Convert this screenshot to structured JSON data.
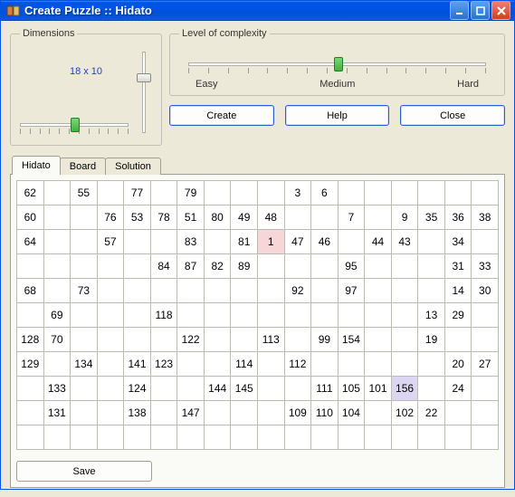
{
  "window": {
    "title": "Create Puzzle :: Hidato"
  },
  "dimensions": {
    "legend": "Dimensions",
    "value": "18 x 10"
  },
  "complexity": {
    "legend": "Level of complexity",
    "labels": {
      "easy": "Easy",
      "medium": "Medium",
      "hard": "Hard"
    }
  },
  "buttons": {
    "create": "Create",
    "help": "Help",
    "close": "Close",
    "save": "Save"
  },
  "tabs": {
    "hidato": "Hidato",
    "board": "Board",
    "solution": "Solution"
  },
  "grid": {
    "cols": 18,
    "rows": 11,
    "cells": [
      [
        "62",
        "",
        "55",
        "",
        "77",
        "",
        "79",
        "",
        "",
        "",
        "3",
        "6",
        "",
        "",
        "",
        "",
        "",
        ""
      ],
      [
        "60",
        "",
        "",
        "76",
        "53",
        "78",
        "51",
        "80",
        "49",
        "48",
        "",
        "",
        "7",
        "",
        "9",
        "35",
        "36",
        "38"
      ],
      [
        "64",
        "",
        "",
        "57",
        "",
        "",
        "83",
        "",
        "81",
        "1",
        "47",
        "46",
        "",
        "44",
        "43",
        "",
        "34",
        ""
      ],
      [
        "",
        "",
        "",
        "",
        "",
        "84",
        "87",
        "82",
        "89",
        "",
        "",
        "",
        "95",
        "",
        "",
        "",
        "31",
        "33"
      ],
      [
        "68",
        "",
        "73",
        "",
        "",
        "",
        "",
        "",
        "",
        "",
        "92",
        "",
        "97",
        "",
        "",
        "",
        "14",
        "30"
      ],
      [
        "",
        "69",
        "",
        "",
        "",
        "118",
        "",
        "",
        "",
        "",
        "",
        "",
        "",
        "",
        "",
        "13",
        "29",
        ""
      ],
      [
        "128",
        "70",
        "",
        "",
        "",
        "",
        "122",
        "",
        "",
        "113",
        "",
        "99",
        "154",
        "",
        "",
        "19",
        "",
        ""
      ],
      [
        "129",
        "",
        "134",
        "",
        "141",
        "123",
        "",
        "",
        "114",
        "",
        "112",
        "",
        "",
        "",
        "",
        "",
        "20",
        "27"
      ],
      [
        "",
        "133",
        "",
        "",
        "124",
        "",
        "",
        "144",
        "145",
        "",
        "",
        "111",
        "105",
        "101",
        "156",
        "",
        "24",
        ""
      ],
      [
        "",
        "131",
        "",
        "",
        "138",
        "",
        "147",
        "",
        "",
        "",
        "109",
        "110",
        "104",
        "",
        "102",
        "22",
        "",
        ""
      ],
      [
        "",
        "",
        "",
        "",
        "",
        "",
        "",
        "",
        "",
        "",
        "",
        "",
        "",
        "",
        "",
        "",
        "",
        ""
      ]
    ],
    "highlights": {
      "pink": [
        [
          2,
          9
        ]
      ],
      "lilac": [
        [
          8,
          14
        ]
      ]
    }
  }
}
